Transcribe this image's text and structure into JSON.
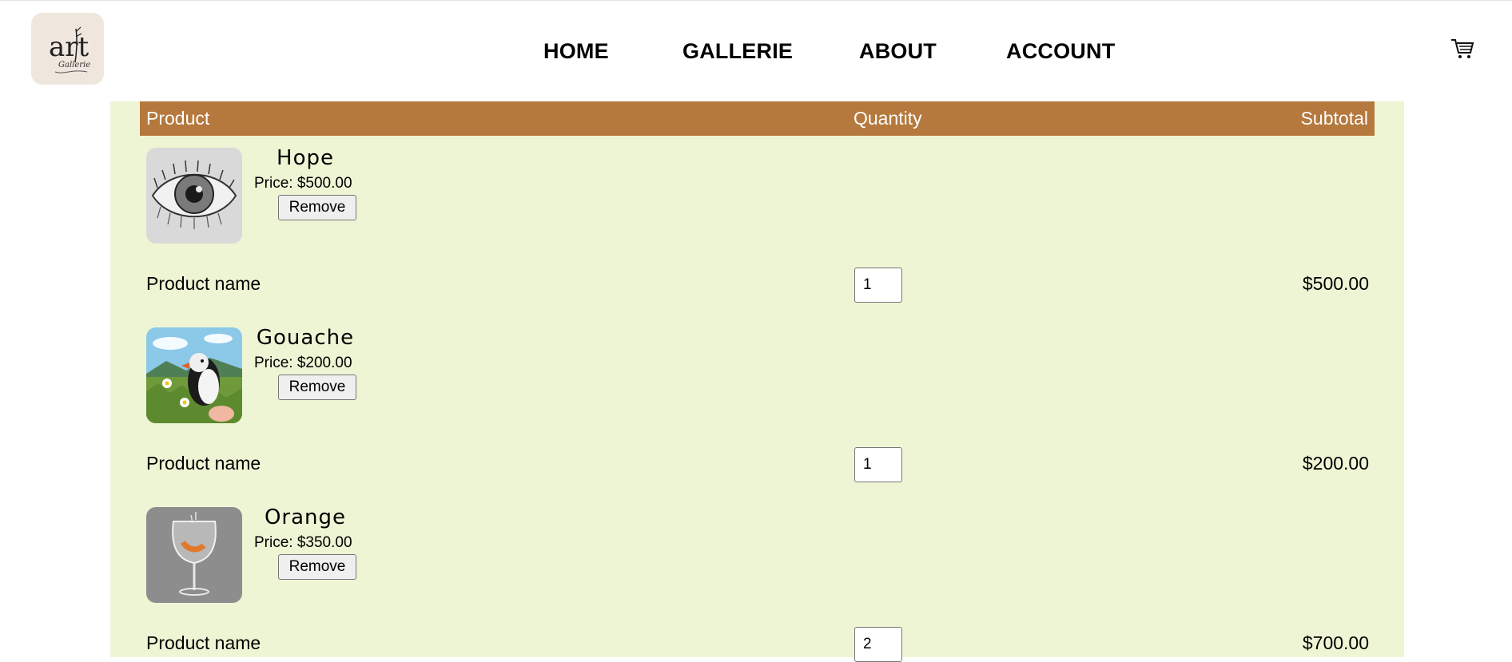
{
  "header": {
    "logo_text": "art",
    "logo_subtext": "Gallerie",
    "nav": [
      "HOME",
      "GALLERIE",
      "ABOUT",
      "ACCOUNT"
    ],
    "cart_icon": "cart-icon"
  },
  "table": {
    "headers": {
      "product": "Product",
      "quantity": "Quantity",
      "subtotal": "Subtotal"
    },
    "rows": [
      {
        "name": "Hope",
        "price": "Price: $500.00",
        "remove": "Remove",
        "label": "Product name",
        "quantity": "1",
        "subtotal": "$500.00",
        "thumb": "eye-drawing"
      },
      {
        "name": "Gouache",
        "price": "Price: $200.00",
        "remove": "Remove",
        "label": "Product name",
        "quantity": "1",
        "subtotal": "$200.00",
        "thumb": "puffin-painting"
      },
      {
        "name": "Orange",
        "price": "Price: $350.00",
        "remove": "Remove",
        "label": "Product name",
        "quantity": "2",
        "subtotal": "$700.00",
        "thumb": "glass-drawing"
      }
    ]
  },
  "colors": {
    "header_bar": "#b5783d",
    "panel": "#eef5d4",
    "logo_bg": "#efe6dd"
  }
}
